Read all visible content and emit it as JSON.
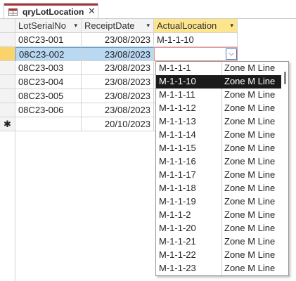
{
  "tab": {
    "title": "qryLotLocation",
    "close_glyph": "✕",
    "icon": "query-icon",
    "accent": "#a4373a"
  },
  "columns": {
    "lot": "LotSerialNo",
    "receipt": "ReceiptDate",
    "actual": "ActualLocation"
  },
  "sort_glyph": "▾",
  "rows": [
    {
      "lot": "08C23-001",
      "receipt": "23/08/2023",
      "actual": "M-1-1-10"
    },
    {
      "lot": "08C23-002",
      "receipt": "23/08/2023",
      "actual": ""
    },
    {
      "lot": "08C23-003",
      "receipt": "23/08/2023",
      "actual": ""
    },
    {
      "lot": "08C23-004",
      "receipt": "23/08/2023",
      "actual": ""
    },
    {
      "lot": "08C23-005",
      "receipt": "23/08/2023",
      "actual": ""
    },
    {
      "lot": "08C23-006",
      "receipt": "23/08/2023",
      "actual": ""
    }
  ],
  "new_row": {
    "marker": "✱",
    "receipt": "20/10/2023"
  },
  "combo_button_glyph": "⌵",
  "dropdown": {
    "items": [
      {
        "code": "M-1-1-1",
        "zone": "Zone M Line"
      },
      {
        "code": "M-1-1-10",
        "zone": "Zone M Line"
      },
      {
        "code": "M-1-1-11",
        "zone": "Zone M Line"
      },
      {
        "code": "M-1-1-12",
        "zone": "Zone M Line"
      },
      {
        "code": "M-1-1-13",
        "zone": "Zone M Line"
      },
      {
        "code": "M-1-1-14",
        "zone": "Zone M Line"
      },
      {
        "code": "M-1-1-15",
        "zone": "Zone M Line"
      },
      {
        "code": "M-1-1-16",
        "zone": "Zone M Line"
      },
      {
        "code": "M-1-1-17",
        "zone": "Zone M Line"
      },
      {
        "code": "M-1-1-18",
        "zone": "Zone M Line"
      },
      {
        "code": "M-1-1-19",
        "zone": "Zone M Line"
      },
      {
        "code": "M-1-1-2",
        "zone": "Zone M Line"
      },
      {
        "code": "M-1-1-20",
        "zone": "Zone M Line"
      },
      {
        "code": "M-1-1-21",
        "zone": "Zone M Line"
      },
      {
        "code": "M-1-1-22",
        "zone": "Zone M Line"
      },
      {
        "code": "M-1-1-23",
        "zone": "Zone M Line"
      }
    ],
    "selected_index": 1
  }
}
